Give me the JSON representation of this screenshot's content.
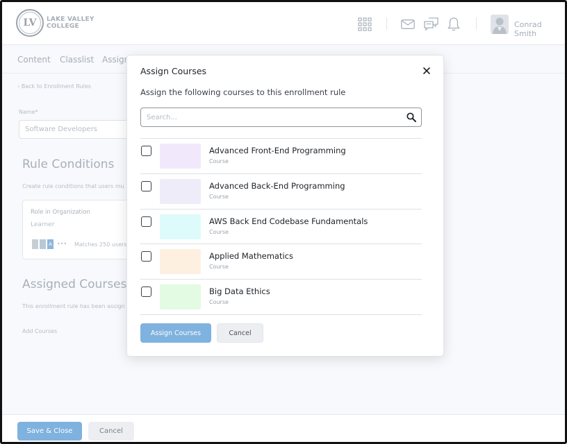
{
  "header": {
    "logo_initials": "LV",
    "logo_line1": "LAKE VALLEY",
    "logo_line2": "COLLEGE",
    "user_name": "Conrad Smith"
  },
  "tabs": [
    {
      "label": "Content"
    },
    {
      "label": "Classlist"
    },
    {
      "label": "Assign"
    }
  ],
  "page": {
    "back_link": "‹ Back to Enrollment Rules",
    "name_label": "Name*",
    "name_value": "Software Developers",
    "rule_conditions_title": "Rule Conditions",
    "rule_conditions_desc": "Create rule conditions that users mu",
    "condition_card": {
      "title": "Role in Organization",
      "value": "Learner",
      "chip_letters": [
        "",
        "",
        "A"
      ],
      "more": "•••",
      "matches": "Matches 250 users"
    },
    "assigned_courses_title": "Assigned Courses",
    "assigned_courses_desc": "This enrollment rule has been assign",
    "add_courses": "Add Courses"
  },
  "footer": {
    "save_close": "Save & Close",
    "cancel": "Cancel"
  },
  "modal": {
    "title": "Assign Courses",
    "subtitle": "Assign the following courses to this enrollment rule",
    "search_placeholder": "Search...",
    "courses": [
      {
        "name": "Advanced Front-End Programming",
        "type": "Course",
        "color": "#f1e9fb"
      },
      {
        "name": "Advanced Back-End Programming",
        "type": "Course",
        "color": "#eeecf9"
      },
      {
        "name": "AWS Back End Codebase Fundamentals",
        "type": "Course",
        "color": "#ddfbfb"
      },
      {
        "name": "Applied Mathematics",
        "type": "Course",
        "color": "#fdf0e1"
      },
      {
        "name": "Big Data Ethics",
        "type": "Course",
        "color": "#e2fbe2"
      }
    ],
    "assign_button": "Assign Courses",
    "cancel_button": "Cancel"
  },
  "colors": {
    "primary": "#7fb2df",
    "secondary": "#eceef1"
  }
}
